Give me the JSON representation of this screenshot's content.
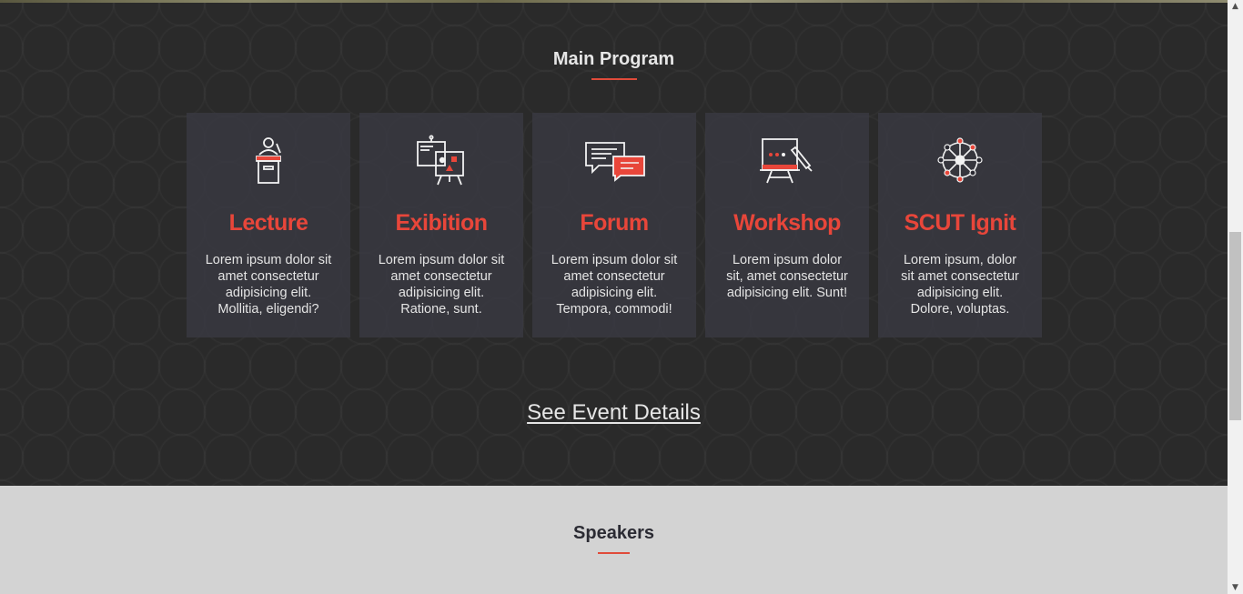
{
  "program": {
    "title": "Main Program",
    "cards": [
      {
        "icon": "podium-icon",
        "title": "Lecture",
        "desc": "Lorem ipsum dolor sit amet consectetur adipisicing elit. Mollitia, eligendi?"
      },
      {
        "icon": "presentation-board-icon",
        "title": "Exibition",
        "desc": "Lorem ipsum dolor sit amet consectetur adipisicing elit. Ratione, sunt."
      },
      {
        "icon": "chat-bubbles-icon",
        "title": "Forum",
        "desc": "Lorem ipsum dolor sit amet consectetur adipisicing elit. Tempora, commodi!"
      },
      {
        "icon": "whiteboard-pen-icon",
        "title": "Workshop",
        "desc": "Lorem ipsum dolor sit, amet consectetur adipisicing elit. Sunt!"
      },
      {
        "icon": "network-hub-icon",
        "title": "SCUT Ignit",
        "desc": "Lorem ipsum, dolor sit amet consectetur adipisicing elit. Dolore, voluptas."
      }
    ],
    "details_link": "See Event Details"
  },
  "speakers": {
    "title": "Speakers"
  },
  "colors": {
    "accent": "#e8463a",
    "dark_bg": "#2a2a2a",
    "card_bg": "#3a3a42",
    "light_bg": "#d3d3d3"
  },
  "scrollbar": {
    "up_arrow": "▲",
    "down_arrow": "▼"
  }
}
